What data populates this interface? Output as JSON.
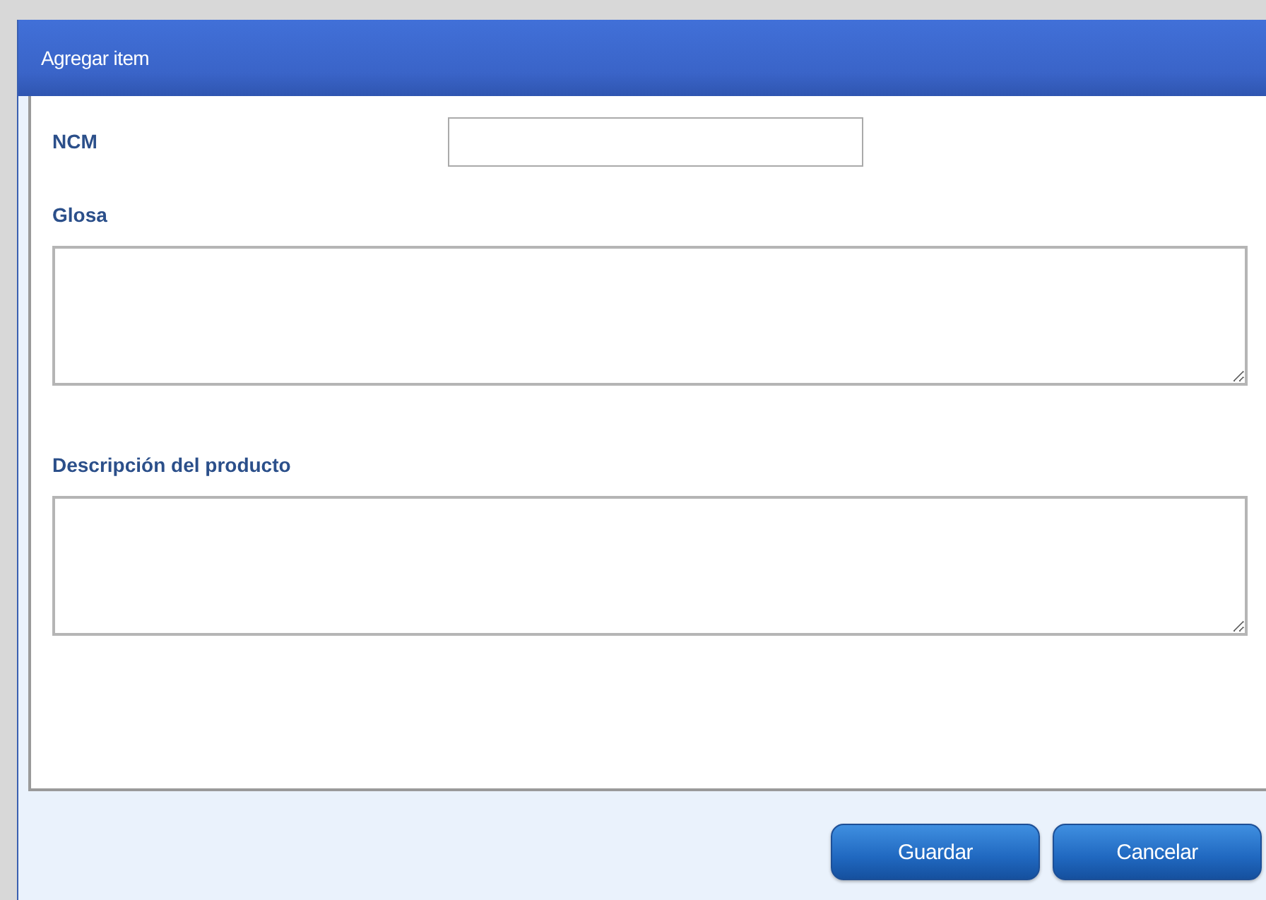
{
  "window": {
    "title": "Agregar item"
  },
  "fields": [
    {
      "kind": "text",
      "label": "NCM"
    },
    {
      "kind": "textarea",
      "label": "Glosa"
    },
    {
      "kind": "textarea",
      "label": "Descripción del producto"
    }
  ],
  "buttons": [
    "Guardar",
    "Cancelar"
  ]
}
